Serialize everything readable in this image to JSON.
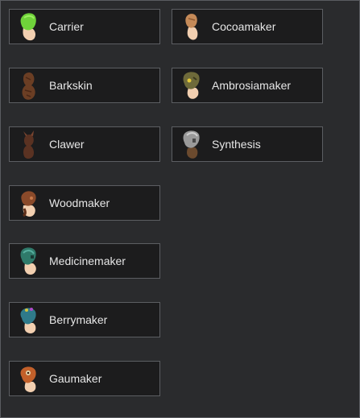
{
  "genes": [
    {
      "id": "carrier",
      "label": "Carrier",
      "icon": "carrier-gene-icon",
      "color": "#6fd23a"
    },
    {
      "id": "barkskin",
      "label": "Barkskin",
      "icon": "barkskin-gene-icon",
      "color": "#6b3e24"
    },
    {
      "id": "clawer",
      "label": "Clawer",
      "icon": "clawer-gene-icon",
      "color": "#5a3222"
    },
    {
      "id": "woodmaker",
      "label": "Woodmaker",
      "icon": "woodmaker-gene-icon",
      "color": "#8a4a2a"
    },
    {
      "id": "medicinemaker",
      "label": "Medicinemaker",
      "icon": "medicinemaker-gene-icon",
      "color": "#2f7a6a"
    },
    {
      "id": "berrymaker",
      "label": "Berrymaker",
      "icon": "berrymaker-gene-icon",
      "color": "#2f7a8a"
    },
    {
      "id": "gaumaker",
      "label": "Gaumaker",
      "icon": "gaumaker-gene-icon",
      "color": "#c2602a"
    },
    {
      "id": "cocoamaker",
      "label": "Cocoamaker",
      "icon": "cocoamaker-gene-icon",
      "color": "#c58a58"
    },
    {
      "id": "ambrosiamaker",
      "label": "Ambrosiamaker",
      "icon": "ambrosiamaker-gene-icon",
      "color": "#6e6a3a"
    },
    {
      "id": "synthesis",
      "label": "Synthesis",
      "icon": "synthesis-gene-icon",
      "color": "#9a9a9a"
    }
  ]
}
